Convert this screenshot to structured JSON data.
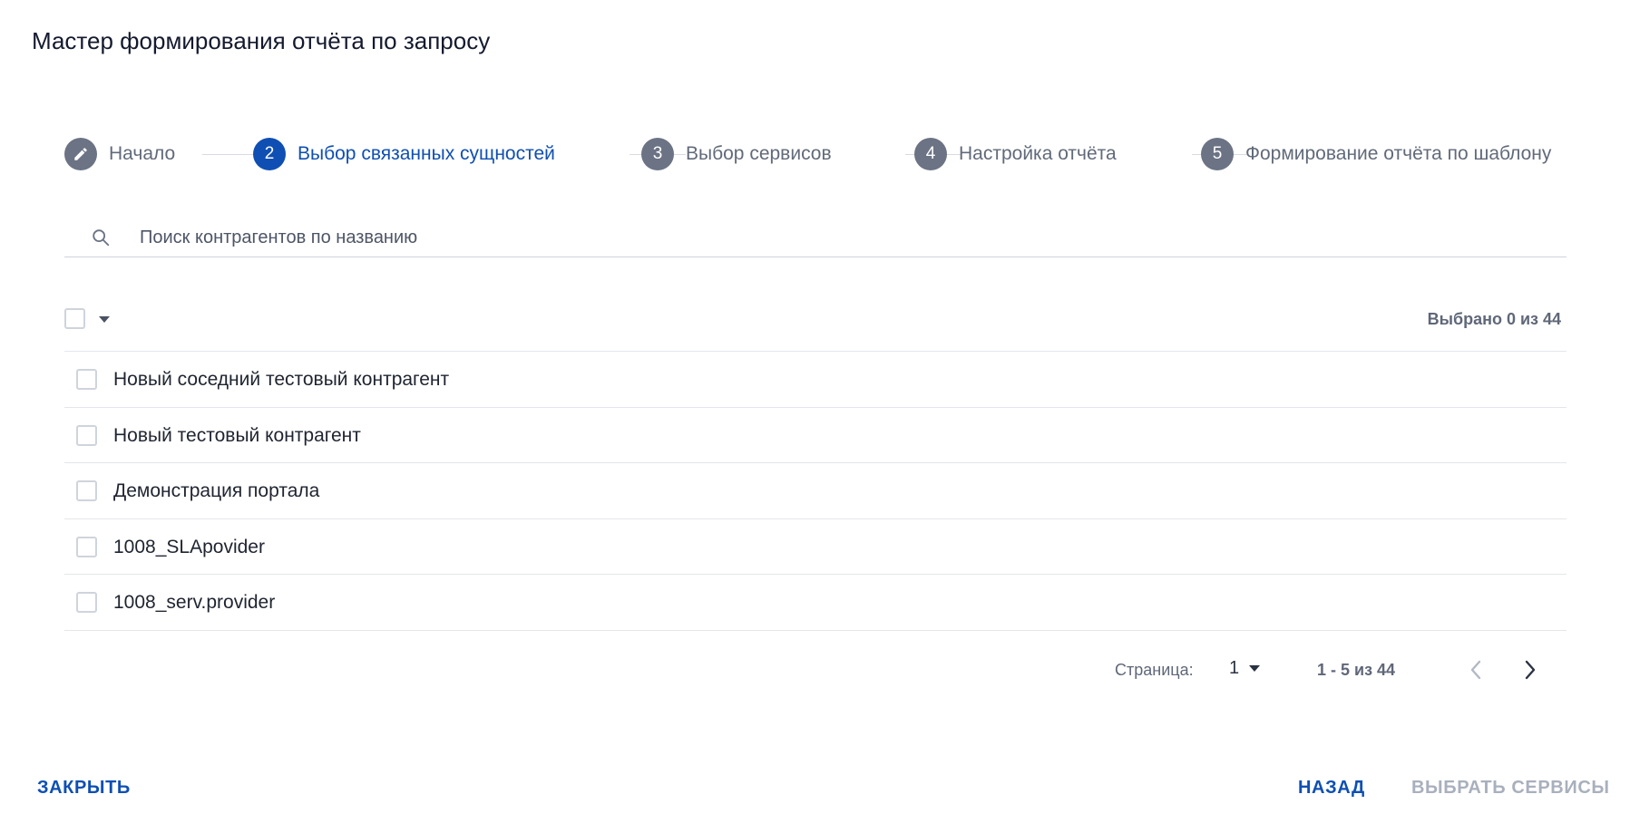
{
  "dialog": {
    "title": "Мастер формирования отчёта по запросу"
  },
  "stepper": {
    "steps": [
      {
        "number": "",
        "label": "Начало",
        "state": "done"
      },
      {
        "number": "2",
        "label": "Выбор связанных сущностей",
        "state": "active"
      },
      {
        "number": "3",
        "label": "Выбор сервисов",
        "state": "pending"
      },
      {
        "number": "4",
        "label": "Настройка отчёта",
        "state": "pending"
      },
      {
        "number": "5",
        "label": "Формирование отчёта по шаблону",
        "state": "pending"
      }
    ]
  },
  "search": {
    "value": "",
    "placeholder": "Поиск контрагентов по названию"
  },
  "toolbar": {
    "selected_text": "Выбрано 0 из 44"
  },
  "list": {
    "items": [
      {
        "label": "Новый соседний тестовый контрагент",
        "checked": false
      },
      {
        "label": "Новый тестовый контрагент",
        "checked": false
      },
      {
        "label": "Демонстрация портала",
        "checked": false
      },
      {
        "label": "1008_SLApovider",
        "checked": false
      },
      {
        "label": "1008_serv.provider",
        "checked": false
      }
    ]
  },
  "pagination": {
    "page_label": "Страница:",
    "page_value": "1",
    "range_text": "1 - 5 из 44"
  },
  "footer": {
    "close_label": "ЗАКРЫТЬ",
    "back_label": "НАЗАД",
    "next_label": "ВЫБРАТЬ СЕРВИСЫ"
  },
  "colors": {
    "accent": "#0f4fb3",
    "step_inactive": "#6b7384",
    "disabled_text": "#a9b0bd"
  },
  "icons": {
    "done_step": "pencil-icon",
    "search": "search-icon",
    "select_menu": "caret-down-icon",
    "prev": "chevron-left-icon",
    "next": "chevron-right-icon"
  }
}
